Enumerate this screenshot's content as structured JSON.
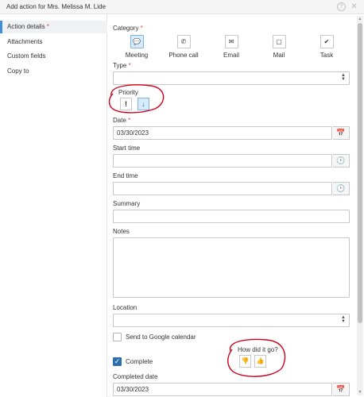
{
  "dialog": {
    "title": "Add action for Mrs. Melissa M. Lide",
    "help_glyph": "?",
    "close_glyph": "✕"
  },
  "sidebar": {
    "items": [
      {
        "label": "Action details",
        "required_mark": "*"
      },
      {
        "label": "Attachments"
      },
      {
        "label": "Custom fields"
      },
      {
        "label": "Copy to"
      }
    ]
  },
  "form": {
    "category": {
      "label": "Category",
      "required_mark": "*",
      "options": [
        {
          "label": "Meeting",
          "icon": "speech-bubble-icon",
          "glyph": "💬",
          "selected": true
        },
        {
          "label": "Phone call",
          "icon": "phone-icon",
          "glyph": "✆",
          "selected": false
        },
        {
          "label": "Email",
          "icon": "envelope-icon",
          "glyph": "✉",
          "selected": false
        },
        {
          "label": "Mail",
          "icon": "note-icon",
          "glyph": "▢",
          "selected": false
        },
        {
          "label": "Task",
          "icon": "checkmark-icon",
          "glyph": "✔",
          "selected": false
        }
      ]
    },
    "type": {
      "label": "Type",
      "required_mark": "*",
      "value": ""
    },
    "priority": {
      "label": "Priority",
      "high_glyph": "!",
      "low_glyph": "↓",
      "selected": "low"
    },
    "date": {
      "label": "Date",
      "required_mark": "*",
      "value": "03/30/2023"
    },
    "start_time": {
      "label": "Start time",
      "value": ""
    },
    "end_time": {
      "label": "End time",
      "value": ""
    },
    "summary": {
      "label": "Summary",
      "value": ""
    },
    "notes": {
      "label": "Notes",
      "value": ""
    },
    "location": {
      "label": "Location",
      "value": ""
    },
    "google_calendar": {
      "label": "Send to Google calendar",
      "checked": false
    },
    "complete": {
      "label": "Complete",
      "checked": true,
      "check_glyph": "✓"
    },
    "outcome": {
      "label": "How did it go?",
      "thumbs_down_glyph": "👎",
      "thumbs_up_glyph": "👍"
    },
    "completed_date": {
      "label": "Completed date",
      "value": "03/30/2023"
    }
  },
  "icons": {
    "calendar_glyph": "📅",
    "clock_glyph": "🕒"
  },
  "colors": {
    "accent": "#3c8fd8",
    "selected_bg": "#d7ebfa",
    "required": "#d9534f",
    "annotation": "#d0021b",
    "checkbox_checked": "#2f6fae"
  }
}
